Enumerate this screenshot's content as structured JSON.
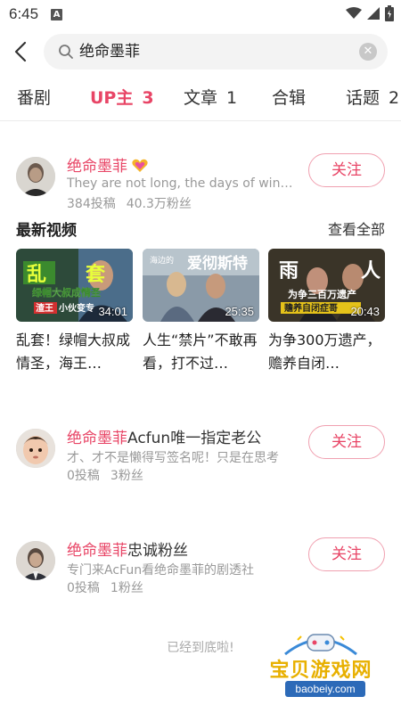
{
  "status_bar": {
    "time": "6:45",
    "a_label": "A"
  },
  "search": {
    "query": "绝命墨菲"
  },
  "tabs": [
    {
      "label": "番剧",
      "count": ""
    },
    {
      "label": "UP主",
      "count": "3"
    },
    {
      "label": "文章",
      "count": "1"
    },
    {
      "label": "合辑",
      "count": ""
    },
    {
      "label": "话题",
      "count": "2"
    }
  ],
  "users": [
    {
      "name_highlight": "绝命墨菲",
      "name_rest": "",
      "signature": "They are not long, the days of wine and roses",
      "posts": "384投稿",
      "fans": "40.3万粉丝",
      "follow_label": "关注"
    },
    {
      "name_highlight": "绝命墨菲",
      "name_rest": "Acfun唯一指定老公",
      "signature": "才、才不是懒得写签名呢！只是在思考",
      "posts": "0投稿",
      "fans": "3粉丝",
      "follow_label": "关注"
    },
    {
      "name_highlight": "绝命墨菲",
      "name_rest": "忠诚粉丝",
      "signature": "专门来AcFun看绝命墨菲的剧透社",
      "posts": "0投稿",
      "fans": "1粉丝",
      "follow_label": "关注"
    }
  ],
  "latest_videos": {
    "title": "最新视频",
    "see_all": "查看全部",
    "items": [
      {
        "title": "乱套！绿帽大叔成情圣，海王…",
        "duration": "34:01",
        "thumb_text": "乱 套 绿帽大叔成情圣 小伙变专"
      },
      {
        "title": "人生“禁片”不敢再看，打不过…",
        "duration": "25:35",
        "thumb_text": "爱彻斯特"
      },
      {
        "title": "为争300万遗产，赡养自闭…",
        "duration": "20:43",
        "thumb_text": "雨 人 为争三百万遗产 赡养自闭症哥"
      }
    ]
  },
  "footer": {
    "end_text": "已经到底啦!"
  },
  "watermark": {
    "brand": "宝贝游戏网",
    "url": "baobeiy.com"
  },
  "colors": {
    "accent": "#e84566",
    "follow_border": "#f0a0b0"
  }
}
